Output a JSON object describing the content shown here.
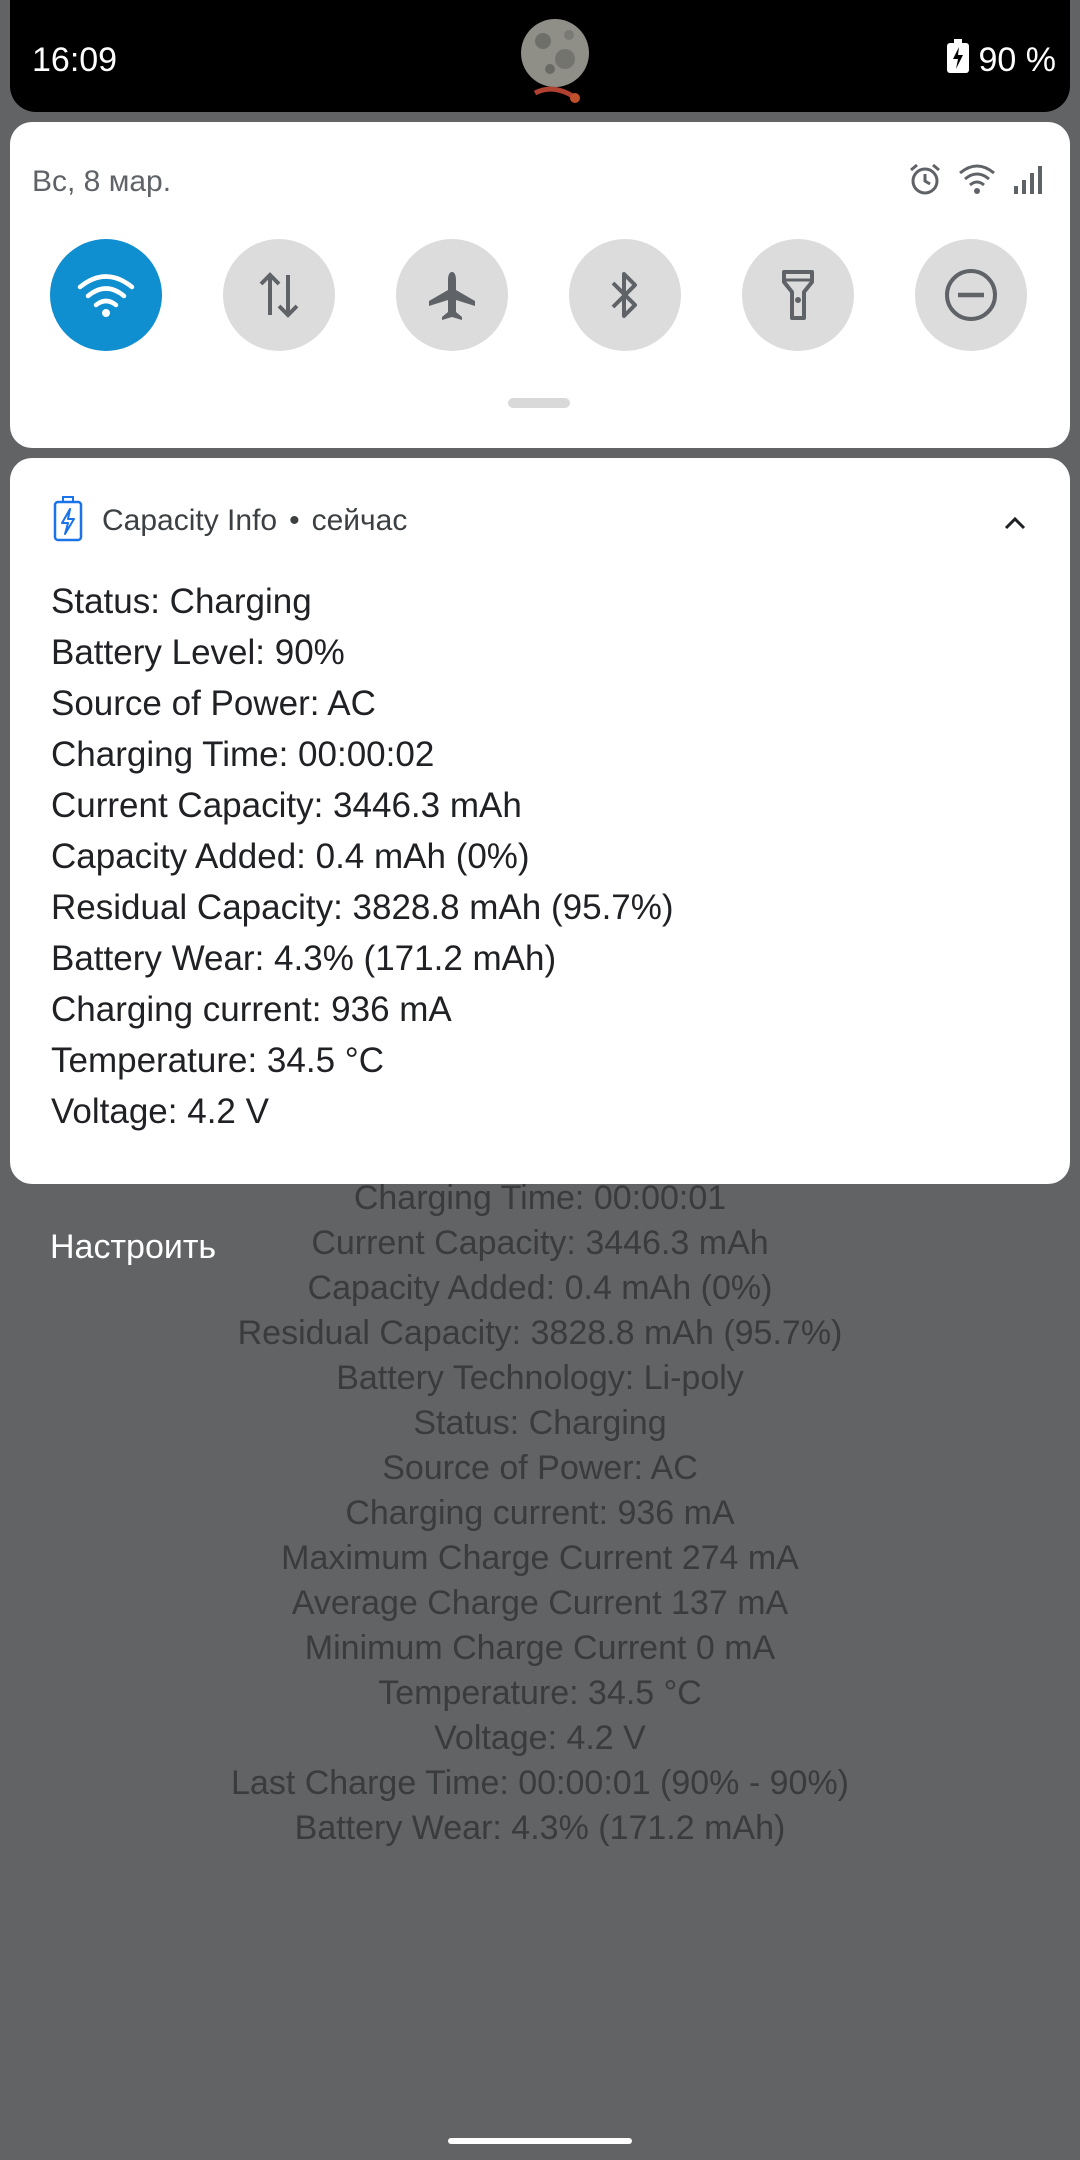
{
  "status_bar": {
    "time": "16:09",
    "battery_text": "90 %",
    "icons": [
      "charging-battery-icon"
    ]
  },
  "quick_settings": {
    "date": "Вс, 8 мар.",
    "header_icons": [
      "alarm-icon",
      "wifi-icon",
      "cell-signal-icon"
    ],
    "tiles": [
      {
        "icon": "wifi-icon",
        "active": true
      },
      {
        "icon": "mobile-data-icon",
        "active": false
      },
      {
        "icon": "airplane-icon",
        "active": false
      },
      {
        "icon": "bluetooth-icon",
        "active": false
      },
      {
        "icon": "flashlight-icon",
        "active": false
      },
      {
        "icon": "do-not-disturb-icon",
        "active": false
      }
    ],
    "active_color": "#0f8ed0"
  },
  "notification": {
    "app_name": "Capacity Info",
    "separator": "•",
    "time": "сейчас",
    "icon": "battery-charging-icon",
    "lines": [
      "Status: Charging",
      "Battery Level: 90%",
      "Source of Power: AC",
      "Charging Time: 00:00:02",
      "Current Capacity: 3446.3 mAh",
      "Capacity Added: 0.4 mAh (0%)",
      "Residual Capacity: 3828.8 mAh (95.7%)",
      "Battery Wear: 4.3% (171.2 mAh)",
      "Charging current: 936 mA",
      "Temperature: 34.5 °C",
      "Voltage: 4.2 V"
    ]
  },
  "configure_label": "Настроить",
  "background_lines": [
    "Charging Time: 00:00:01",
    "Current Capacity: 3446.3 mAh",
    "Capacity Added: 0.4 mAh (0%)",
    "Residual Capacity: 3828.8 mAh (95.7%)",
    "Battery Technology: Li-poly",
    "Status: Charging",
    "Source of Power: AC",
    "Charging current: 936 mA",
    "Maximum Charge Current 274 mA",
    "Average Charge Current 137 mA",
    "Minimum Charge Current 0 mA",
    "Temperature: 34.5 °C",
    "Voltage: 4.2 V",
    "Last Charge Time: 00:00:01 (90% - 90%)",
    "Battery Wear: 4.3% (171.2 mAh)"
  ]
}
